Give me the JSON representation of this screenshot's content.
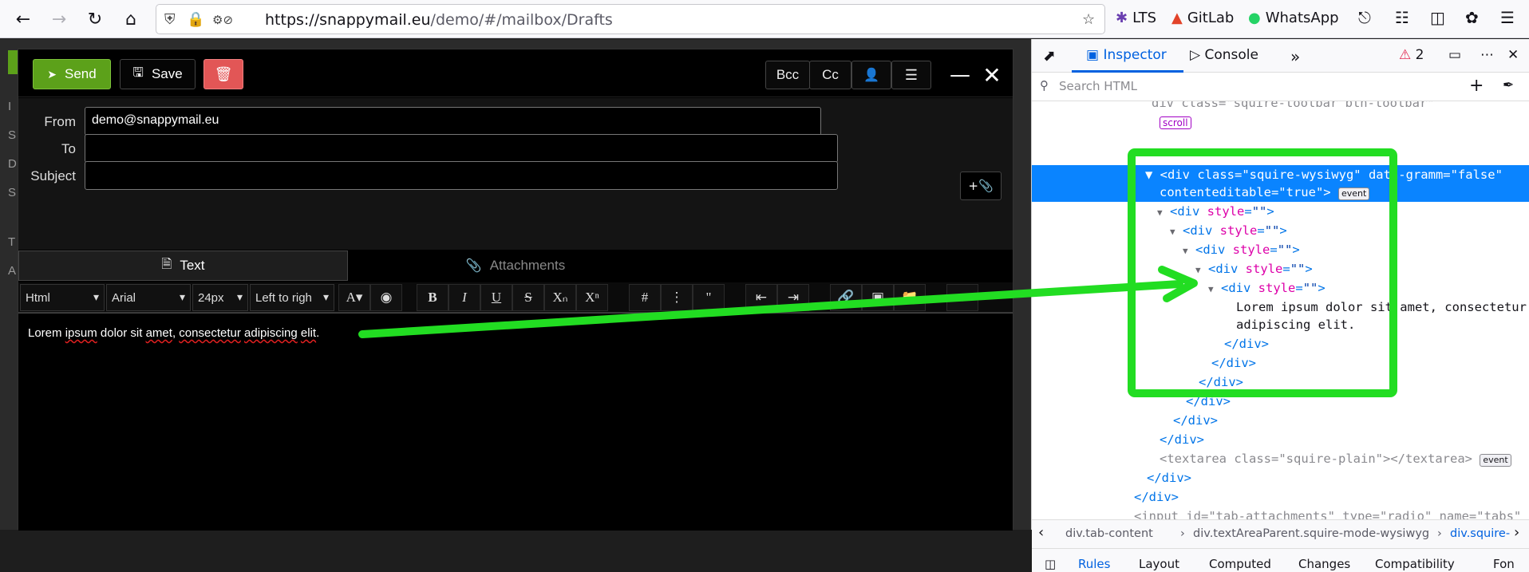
{
  "browser": {
    "url_host": "https://snappymail.eu",
    "url_path": "/demo/#/mailbox/Drafts",
    "bookmarks": [
      {
        "label": "LTS",
        "icon": "lts-icon"
      },
      {
        "label": "GitLab",
        "icon": "gitlab-icon"
      },
      {
        "label": "WhatsApp",
        "icon": "whatsapp-icon"
      }
    ]
  },
  "sidebar_fragments": [
    "I",
    "S",
    "D",
    "S",
    "T",
    "A"
  ],
  "compose": {
    "send_label": "Send",
    "save_label": "Save",
    "bcc_label": "Bcc",
    "cc_label": "Cc",
    "from_label": "From",
    "from_value": "demo@snappymail.eu",
    "to_label": "To",
    "to_value": "",
    "subject_label": "Subject",
    "subject_value": "",
    "tab_text": "Text",
    "tab_attachments": "Attachments",
    "format_select": "Html",
    "font_select": "Arial",
    "size_select": "24px",
    "align_select": "Left to righ",
    "editor_body": "Lorem ipsum dolor sit amet, consectetur adipiscing elit."
  },
  "devtools": {
    "tab_inspector": "Inspector",
    "tab_console": "Console",
    "error_count": "2",
    "search_placeholder": "Search HTML",
    "scroll_badge": "scroll",
    "event_badge": "event",
    "crumbs": [
      "div.tab-content",
      "div.textAreaParent.squire-mode-wysiwyg",
      "div.squire-"
    ],
    "panel_tabs": [
      "Rules",
      "Layout",
      "Computed",
      "Changes",
      "Compatibility",
      "Fon"
    ]
  },
  "colors": {
    "send_green": "#5ca11a",
    "delete_red": "#e25656",
    "devtools_selection": "#0a84ff",
    "annotation_green": "#22dd22"
  }
}
